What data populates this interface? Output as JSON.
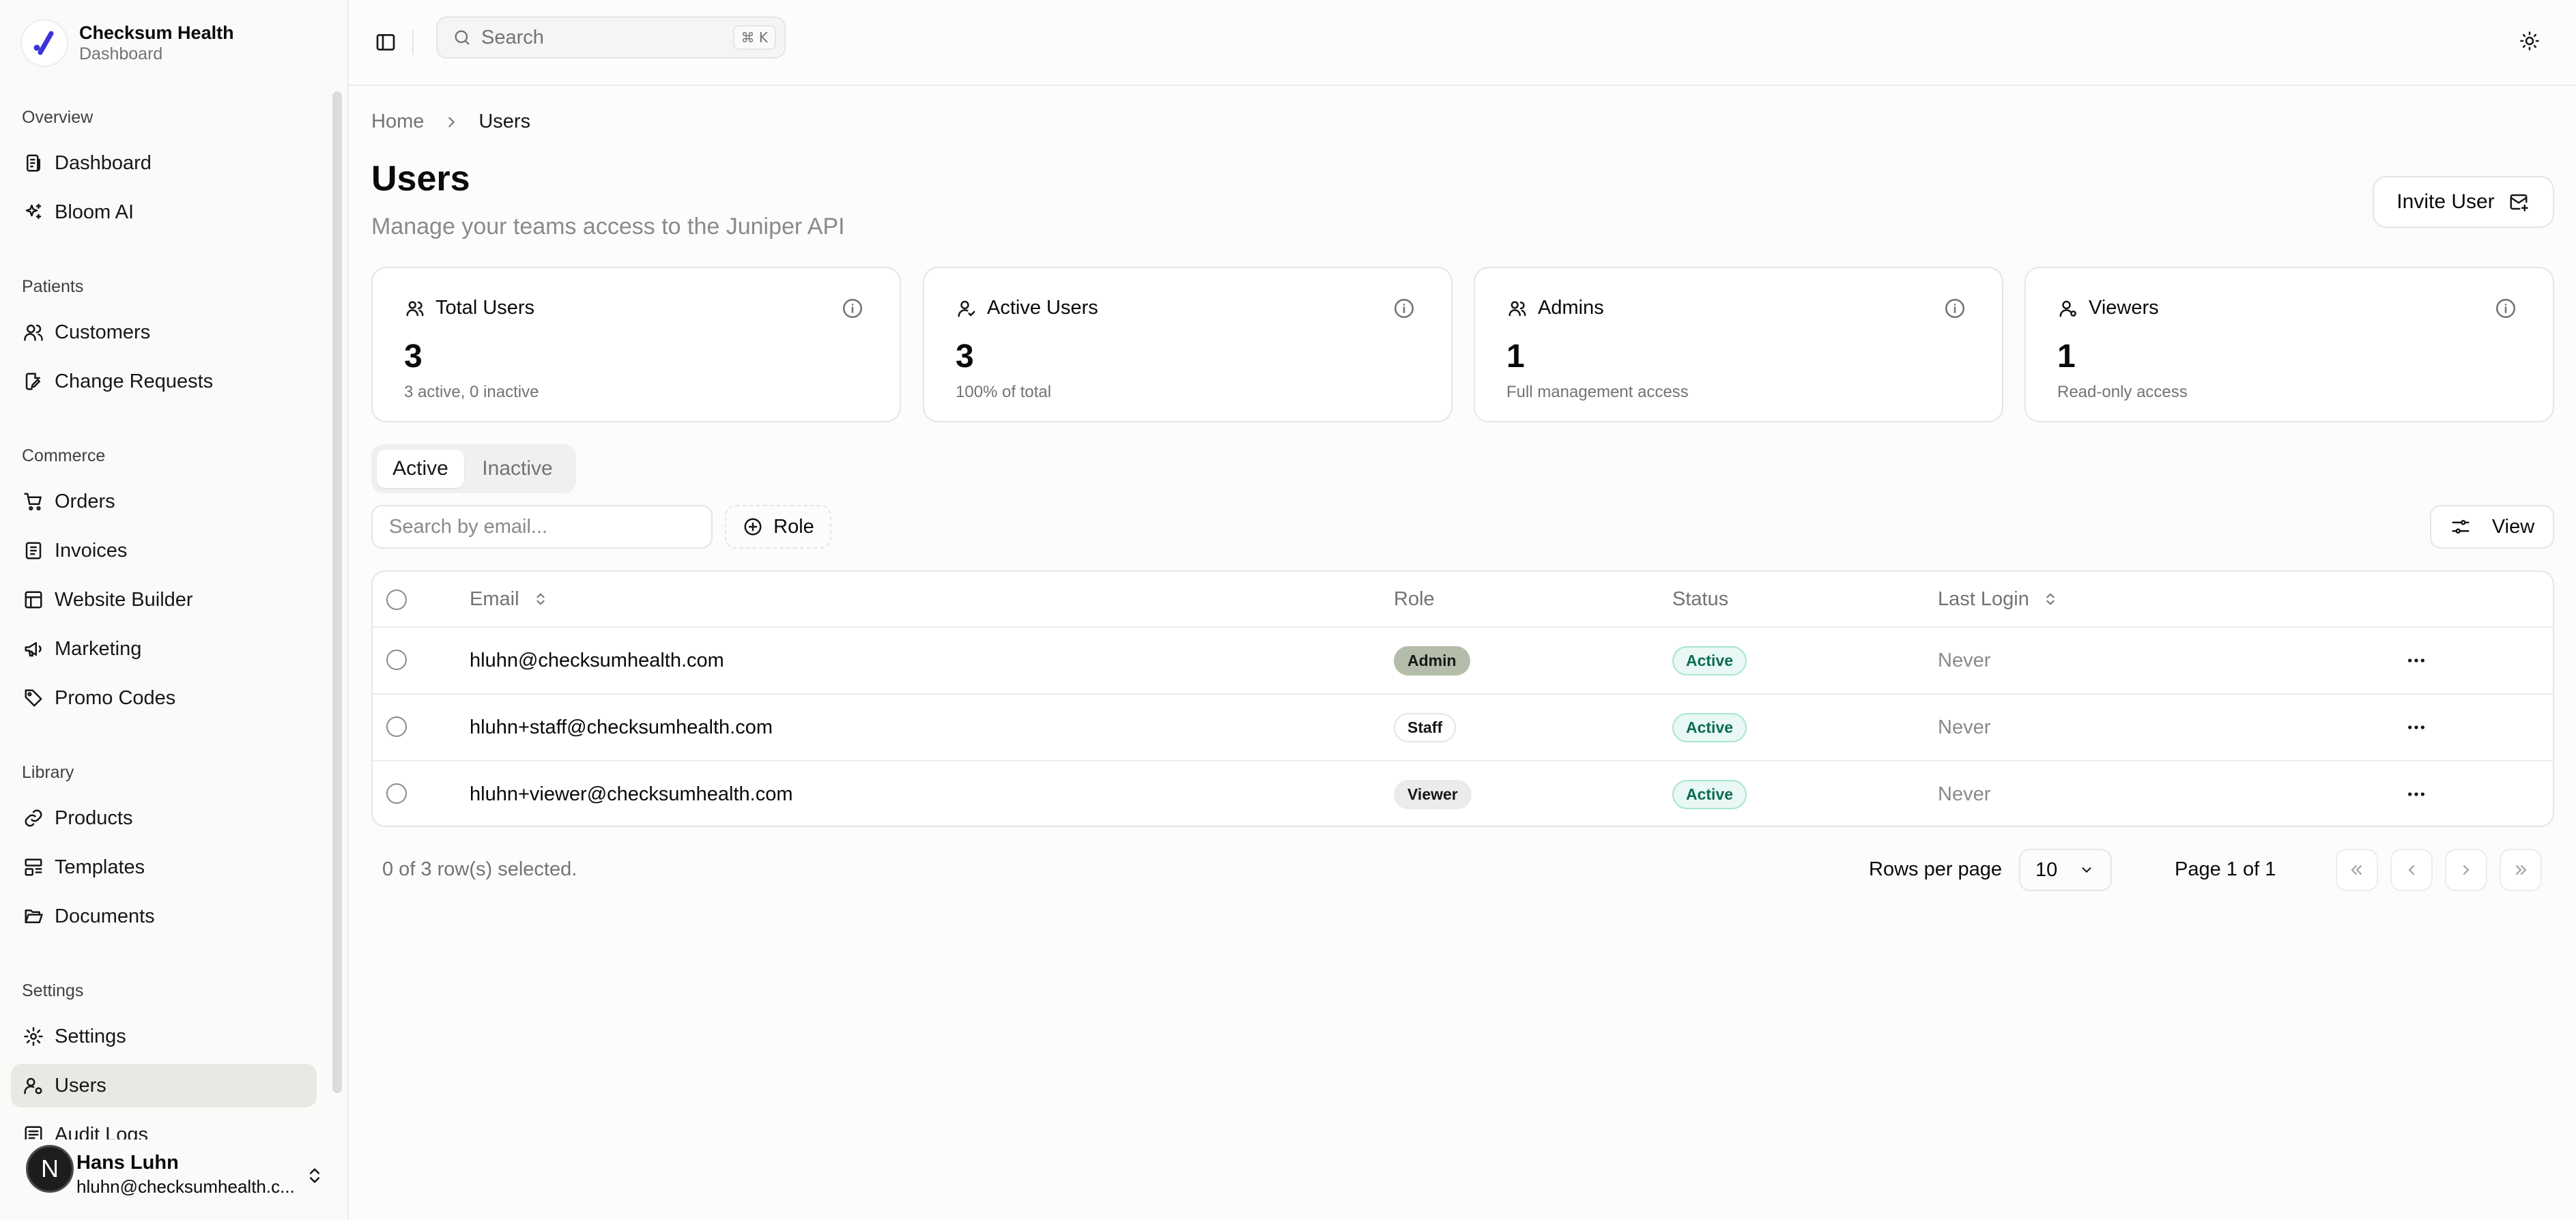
{
  "brand": {
    "name": "Checksum Health",
    "subtitle": "Dashboard"
  },
  "sidebar": {
    "groups": [
      {
        "label": "Overview",
        "items": [
          {
            "label": "Dashboard",
            "icon": "dashboard-icon"
          },
          {
            "label": "Bloom AI",
            "icon": "sparkles-icon"
          }
        ]
      },
      {
        "label": "Patients",
        "items": [
          {
            "label": "Customers",
            "icon": "users-icon"
          },
          {
            "label": "Change Requests",
            "icon": "file-edit-icon"
          }
        ]
      },
      {
        "label": "Commerce",
        "items": [
          {
            "label": "Orders",
            "icon": "cart-icon"
          },
          {
            "label": "Invoices",
            "icon": "receipt-icon"
          },
          {
            "label": "Website Builder",
            "icon": "layout-icon"
          },
          {
            "label": "Marketing",
            "icon": "megaphone-icon"
          },
          {
            "label": "Promo Codes",
            "icon": "tag-icon"
          }
        ]
      },
      {
        "label": "Library",
        "items": [
          {
            "label": "Products",
            "icon": "link-icon"
          },
          {
            "label": "Templates",
            "icon": "template-icon"
          },
          {
            "label": "Documents",
            "icon": "folder-open-icon"
          }
        ]
      },
      {
        "label": "Settings",
        "items": [
          {
            "label": "Settings",
            "icon": "gear-icon"
          },
          {
            "label": "Users",
            "icon": "user-cog-icon",
            "active": true
          },
          {
            "label": "Audit Logs",
            "icon": "log-icon"
          }
        ]
      }
    ],
    "user": {
      "initial": "N",
      "name": "Hans Luhn",
      "email": "hluhn@checksumhealth.c..."
    }
  },
  "topbar": {
    "search_label": "Search",
    "search_shortcut": "⌘ K"
  },
  "breadcrumb": {
    "home": "Home",
    "current": "Users"
  },
  "page": {
    "title": "Users",
    "subtitle": "Manage your teams access to the Juniper API",
    "invite_label": "Invite User"
  },
  "stats": [
    {
      "title": "Total Users",
      "value": "3",
      "note": "3 active, 0 inactive",
      "icon": "users-round-icon"
    },
    {
      "title": "Active Users",
      "value": "3",
      "note": "100% of total",
      "icon": "user-check-icon"
    },
    {
      "title": "Admins",
      "value": "1",
      "note": "Full management access",
      "icon": "users-round-icon"
    },
    {
      "title": "Viewers",
      "value": "1",
      "note": "Read-only access",
      "icon": "user-icon"
    }
  ],
  "tabs": {
    "active": "Active",
    "inactive": "Inactive"
  },
  "filters": {
    "email_placeholder": "Search by email...",
    "role_label": "Role",
    "view_label": "View"
  },
  "table": {
    "columns": {
      "email": "Email",
      "role": "Role",
      "status": "Status",
      "last_login": "Last Login"
    },
    "rows": [
      {
        "email": "hluhn@checksumhealth.com",
        "role": "Admin",
        "status": "Active",
        "last_login": "Never"
      },
      {
        "email": "hluhn+staff@checksumhealth.com",
        "role": "Staff",
        "status": "Active",
        "last_login": "Never"
      },
      {
        "email": "hluhn+viewer@checksumhealth.com",
        "role": "Viewer",
        "status": "Active",
        "last_login": "Never"
      }
    ]
  },
  "pagination": {
    "selection": "0 of 3 row(s) selected.",
    "rows_per_page_label": "Rows per page",
    "rows_per_page": "10",
    "page_info": "Page 1 of 1"
  },
  "colors": {
    "accent": "#3b33d6",
    "active_nav_bg": "#e7e9e3",
    "admin_badge": "#b4bda9",
    "status_badge_text": "#0d6b55"
  }
}
